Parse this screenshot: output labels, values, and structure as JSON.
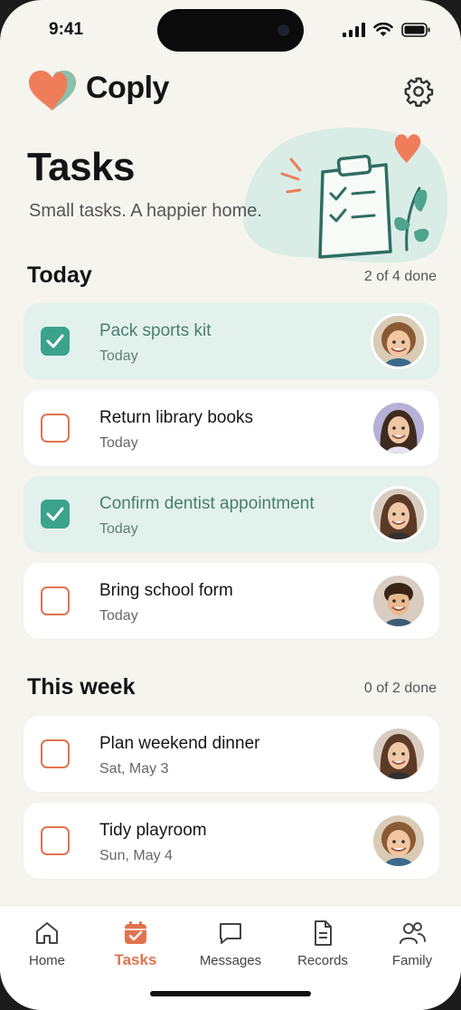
{
  "status_bar": {
    "time": "9:41"
  },
  "app": {
    "brand": "Coply"
  },
  "colors": {
    "accent": "#e0734f",
    "done_green": "#3ba38b",
    "done_bg": "#e3f1ec",
    "background": "#f6f4ef"
  },
  "page": {
    "title": "Tasks",
    "subtitle": "Small tasks. A happier home."
  },
  "sections": [
    {
      "title": "Today",
      "count": "2 of 4 done",
      "tasks": [
        {
          "title": "Pack sports kit",
          "date": "Today",
          "done": true
        },
        {
          "title": "Return library books",
          "date": "Today",
          "done": false
        },
        {
          "title": "Confirm dentist appointment",
          "date": "Today",
          "done": true
        },
        {
          "title": "Bring school form",
          "date": "Today",
          "done": false
        }
      ]
    },
    {
      "title": "This week",
      "count": "0 of 2 done",
      "tasks": [
        {
          "title": "Plan weekend dinner",
          "date": "Sat, May 3",
          "done": false
        },
        {
          "title": "Tidy playroom",
          "date": "Sun, May 4",
          "done": false
        }
      ]
    }
  ],
  "tabs": [
    {
      "label": "Home",
      "icon": "home-icon",
      "active": false
    },
    {
      "label": "Tasks",
      "icon": "calendar-check-icon",
      "active": true
    },
    {
      "label": "Messages",
      "icon": "message-icon",
      "active": false
    },
    {
      "label": "Records",
      "icon": "document-icon",
      "active": false
    },
    {
      "label": "Family",
      "icon": "people-icon",
      "active": false
    }
  ]
}
